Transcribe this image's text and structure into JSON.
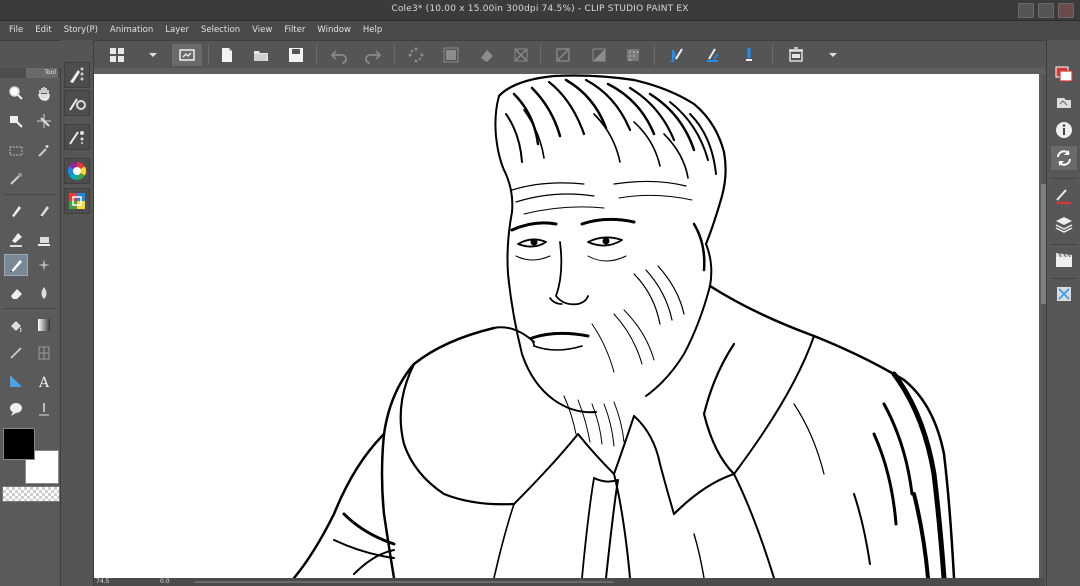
{
  "window": {
    "title": "Cole3* (10.00 x 15.00in 300dpi 74.5%) - CLIP STUDIO PAINT EX"
  },
  "menu": {
    "items": [
      "File",
      "Edit",
      "Story(P)",
      "Animation",
      "Layer",
      "Selection",
      "View",
      "Filter",
      "Window",
      "Help"
    ]
  },
  "tool_panel": {
    "tab_label": "Tool",
    "active_tool": "pen-icon"
  },
  "colors": {
    "main": "#000000",
    "sub": "#ffffff",
    "ui_background": "#5f5f5f",
    "active_tool_highlight": "#7a8896",
    "layer_icon_red": "#d23a3a"
  },
  "status": {
    "zoom": "74.5",
    "angle": "0.0"
  },
  "icons": {
    "command_bar": [
      "grid-icon",
      "chevron-down-icon",
      "clip-studio-icon",
      "new-file-icon",
      "open-folder-icon",
      "save-icon",
      "undo-icon",
      "redo-icon",
      "selection-dots-icon",
      "transform-icon",
      "fill-selection-icon",
      "crop-icon",
      "clear-icon",
      "fill-icon",
      "screentone-icon",
      "ruler-pen-1-icon",
      "ruler-pen-2-icon",
      "ruler-pen-3-icon",
      "trash-icon",
      "chevron-down-icon"
    ],
    "right_panel": [
      "navigator-icon",
      "subview-icon",
      "info-icon",
      "sync-icon",
      "layer-property-icon",
      "layers-icon",
      "timeline-icon",
      "material-icon"
    ]
  }
}
